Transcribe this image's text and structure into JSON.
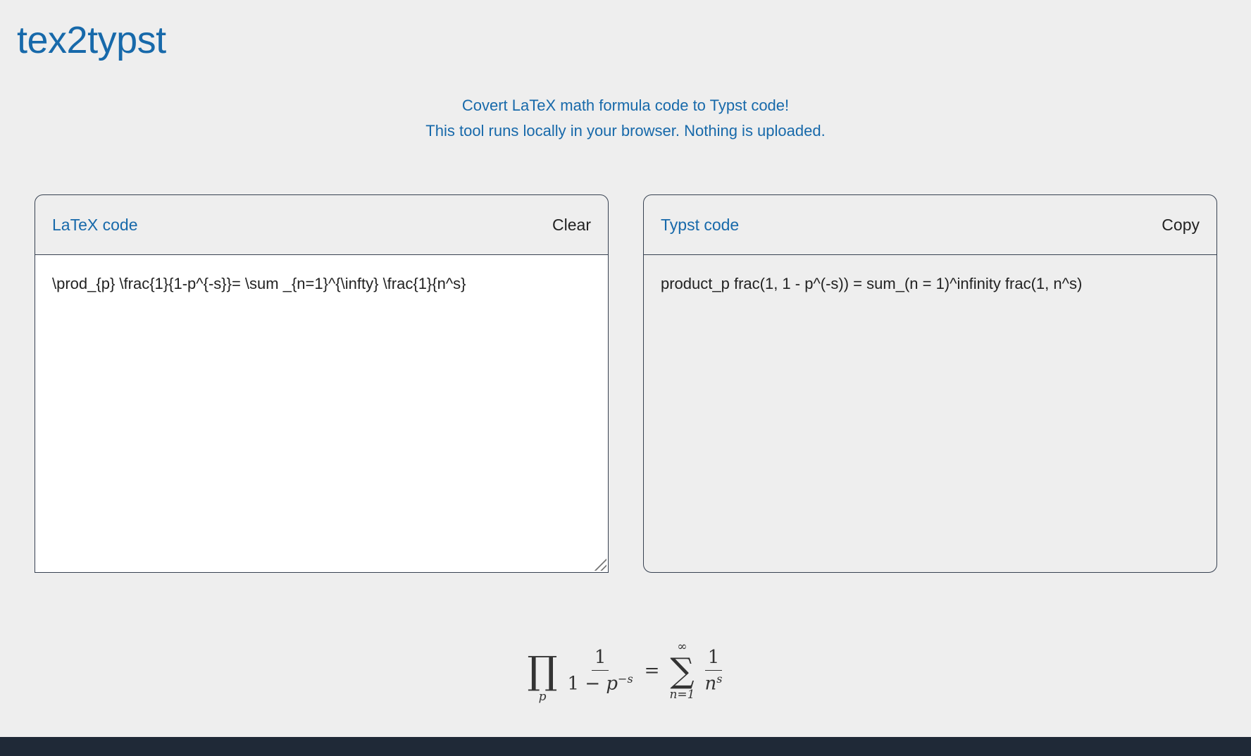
{
  "header": {
    "title": "tex2typst"
  },
  "intro": {
    "line1": "Covert LaTeX math formula code to Typst code!",
    "line2": "This tool runs locally in your browser. Nothing is uploaded."
  },
  "latex_panel": {
    "label": "LaTeX code",
    "clear_label": "Clear",
    "value": "\\prod_{p} \\frac{1}{1-p^{-s}}= \\sum _{n=1}^{\\infty} \\frac{1}{n^s}"
  },
  "typst_panel": {
    "label": "Typst code",
    "copy_label": "Copy",
    "value": "product_p frac(1, 1 - p^(-s)) = sum_(n = 1)^infinity frac(1, n^s)"
  },
  "preview": {
    "prod": "∏",
    "prod_sub": "p",
    "num1": "1",
    "den1_a": "1 − ",
    "den1_p": "p",
    "den1_sup": "−s",
    "eq": "=",
    "sum": "∑",
    "sum_sup": "∞",
    "sum_sub": "n=1",
    "num2": "1",
    "den2_n": "n",
    "den2_sup": "s"
  },
  "colors": {
    "accent": "#1769aa",
    "background": "#eeeeee",
    "footer": "#1f2937"
  }
}
